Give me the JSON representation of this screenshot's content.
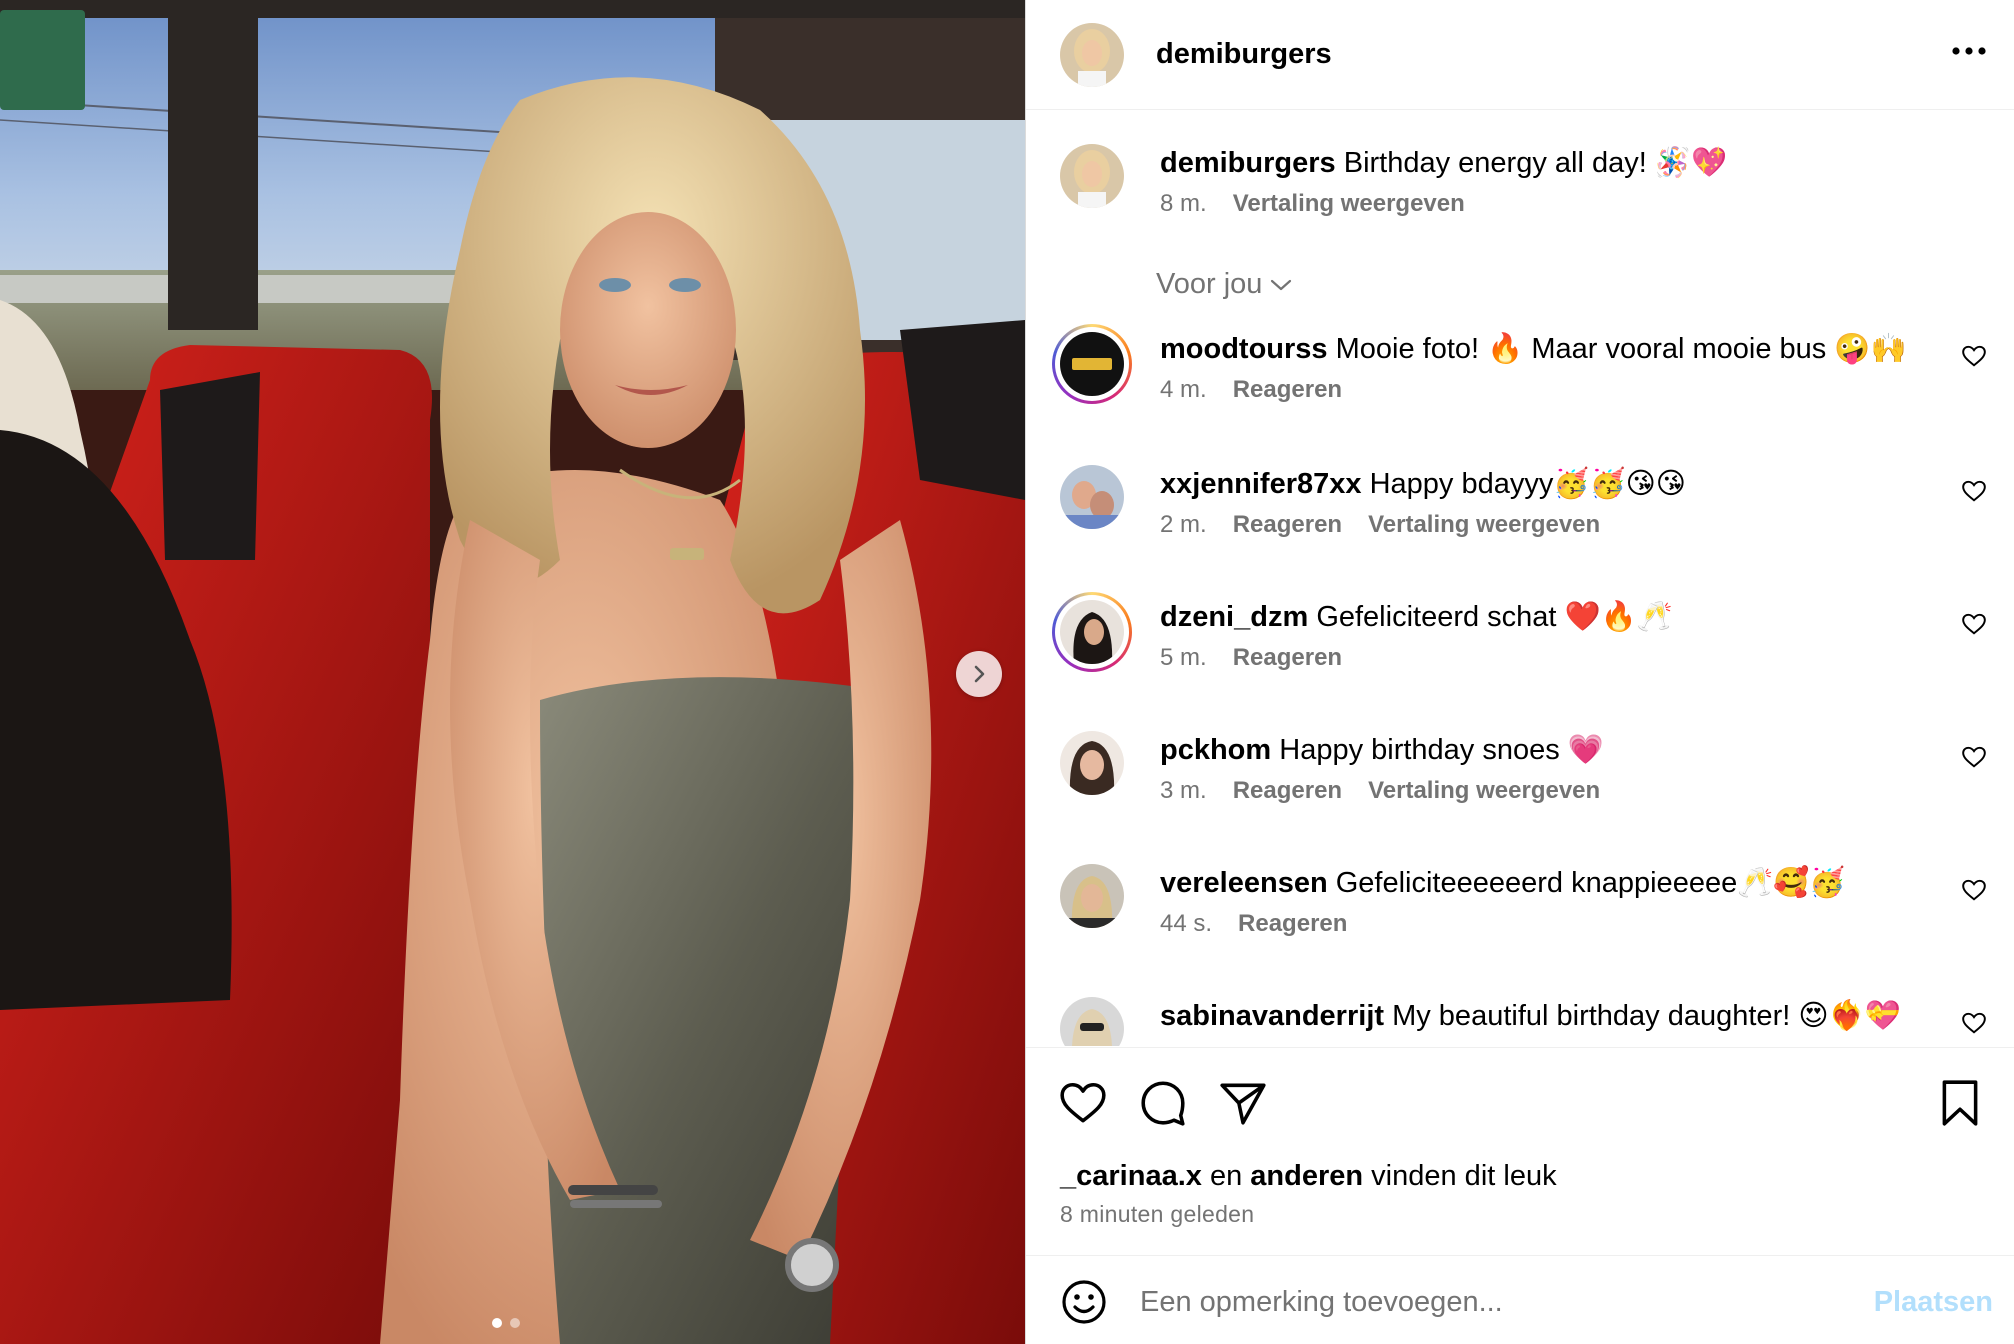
{
  "post": {
    "author": "demiburgers",
    "caption": "Birthday energy all day! 🪅💖",
    "caption_time": "8 m.",
    "caption_translate": "Vertaling weergeven",
    "carousel": {
      "current": 1,
      "total": 2
    }
  },
  "sort_label": "Voor jou",
  "comments": [
    {
      "user": "moodtourss",
      "text": "Mooie foto! 🔥 Maar vooral mooie bus 🤪🙌",
      "time": "4 m.",
      "reply": "Reageren",
      "translate": ""
    },
    {
      "user": "xxjennifer87xx",
      "text": "Happy bdayyy🥳🥳😘😘",
      "time": "2 m.",
      "reply": "Reageren",
      "translate": "Vertaling weergeven"
    },
    {
      "user": "dzeni_dzm",
      "text": "Gefeliciteerd schat ❤️🔥🥂",
      "time": "5 m.",
      "reply": "Reageren",
      "translate": ""
    },
    {
      "user": "pckhom",
      "text": "Happy birthday snoes 💗",
      "time": "3 m.",
      "reply": "Reageren",
      "translate": "Vertaling weergeven"
    },
    {
      "user": "vereleensen",
      "text": "Gefeliciteeeeeerd knappieeeee🥂🥰🥳",
      "time": "44 s.",
      "reply": "Reageren",
      "translate": ""
    },
    {
      "user": "sabinavanderrijt",
      "text": "My beautiful birthday daughter! 😍❤️‍🔥💝",
      "time": "",
      "reply": "",
      "translate": ""
    }
  ],
  "likes": {
    "first_user": "_carinaa.x",
    "connector": "en",
    "others": "anderen",
    "suffix": "vinden dit leuk"
  },
  "timestamp": "8 minuten geleden",
  "composer": {
    "placeholder": "Een opmerking toevoegen...",
    "post_label": "Plaatsen"
  },
  "icons": {
    "like": "heart-icon",
    "comment": "comment-icon",
    "share": "send-icon",
    "save": "bookmark-icon",
    "more": "more-icon",
    "emoji": "emoji-icon",
    "next": "chevron-right-icon",
    "sort": "chevron-down-icon"
  },
  "colors": {
    "link": "#0095f6",
    "post_disabled": "#b2dffc",
    "muted": "#737373"
  }
}
